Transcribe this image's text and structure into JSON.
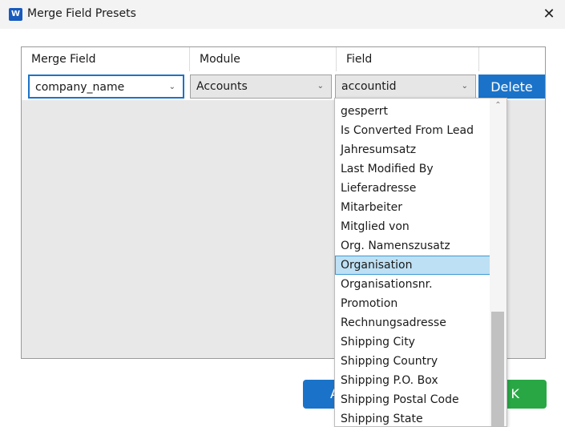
{
  "window": {
    "title": "Merge Field Presets",
    "app_icon_letter": "W",
    "close_glyph": "✕"
  },
  "grid": {
    "columns": [
      "Merge Field",
      "Module",
      "Field"
    ],
    "row": {
      "merge_field": "company_name",
      "module": "Accounts",
      "field": "accountid",
      "delete_label": "Delete"
    }
  },
  "dropdown": {
    "items": [
      "gesperrt",
      "Is Converted From Lead",
      "Jahresumsatz",
      "Last Modified By",
      "Lieferadresse",
      "Mitarbeiter",
      "Mitglied von",
      "Org. Namenszusatz",
      "Organisation",
      "Organisationsnr.",
      "Promotion",
      "Rechnungsadresse",
      "Shipping City",
      "Shipping Country",
      "Shipping P.O. Box",
      "Shipping Postal Code",
      "Shipping State"
    ],
    "selected_index": 8
  },
  "buttons": {
    "add_visible": "A",
    "ok_visible": "K"
  },
  "icons": {
    "chevron": "chevron-down-icon",
    "scroll_up": "chevron-up-icon"
  },
  "colors": {
    "accent": "#1b73c9",
    "ok": "#29a745",
    "selection": "#bee0f4"
  }
}
